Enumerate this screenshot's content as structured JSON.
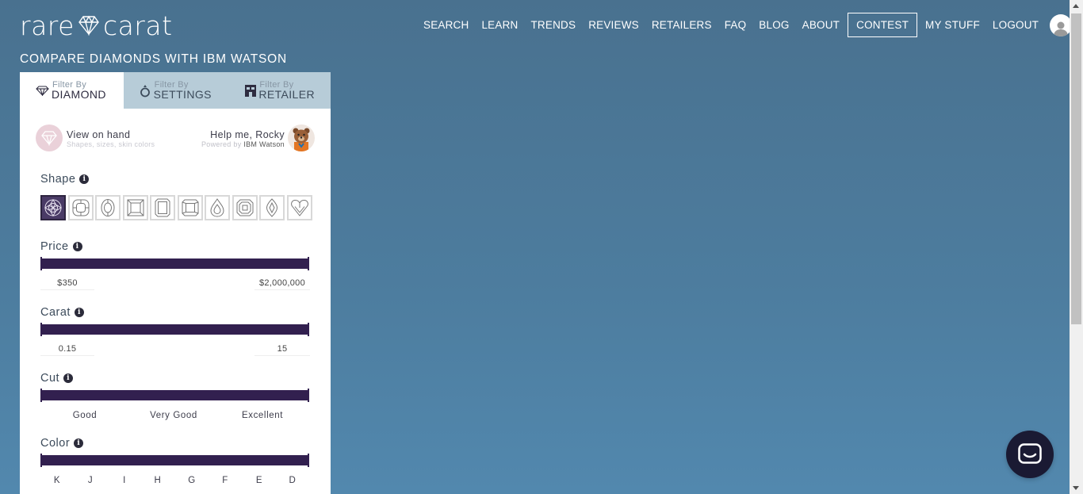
{
  "logo": {
    "left": "rare",
    "right": "carat"
  },
  "nav": {
    "items": [
      "SEARCH",
      "LEARN",
      "TRENDS",
      "REVIEWS",
      "RETAILERS",
      "FAQ",
      "BLOG",
      "ABOUT",
      "CONTEST",
      "MY STUFF",
      "LOGOUT"
    ]
  },
  "heading": {
    "prefix": "COMPARE DIAMONDS WITH ",
    "emph": "IBM WATSON"
  },
  "tabs": [
    {
      "small": "Filter By",
      "big": "DIAMOND",
      "icon": "diamond-icon",
      "active": true
    },
    {
      "small": "Filter By",
      "big": "SETTINGS",
      "icon": "ring-icon",
      "active": false
    },
    {
      "small": "Filter By",
      "big": "RETAILER",
      "icon": "store-icon",
      "active": false
    }
  ],
  "view_on_hand": {
    "title": "View on hand",
    "subtitle": "Shapes, sizes, skin colors"
  },
  "rocky": {
    "title": "Help me, Rocky",
    "subtitle_prefix": "Powered by ",
    "subtitle_brand": "IBM Watson"
  },
  "filters": {
    "shape": {
      "label": "Shape",
      "options": [
        "round",
        "cushion",
        "oval",
        "princess",
        "emerald",
        "radiant",
        "pear",
        "asscher",
        "marquise",
        "heart"
      ],
      "selected": "round"
    },
    "price": {
      "label": "Price",
      "min": "$350",
      "max": "$2,000,000"
    },
    "carat": {
      "label": "Carat",
      "min": "0.15",
      "max": "15"
    },
    "cut": {
      "label": "Cut",
      "ticks": [
        "Good",
        "Very Good",
        "Excellent"
      ]
    },
    "color": {
      "label": "Color",
      "ticks": [
        "K",
        "J",
        "I",
        "H",
        "G",
        "F",
        "E",
        "D"
      ]
    }
  },
  "colors": {
    "accent": "#32204f",
    "tab_bar": "#b7ccd8",
    "background": "#4d7d9f"
  }
}
